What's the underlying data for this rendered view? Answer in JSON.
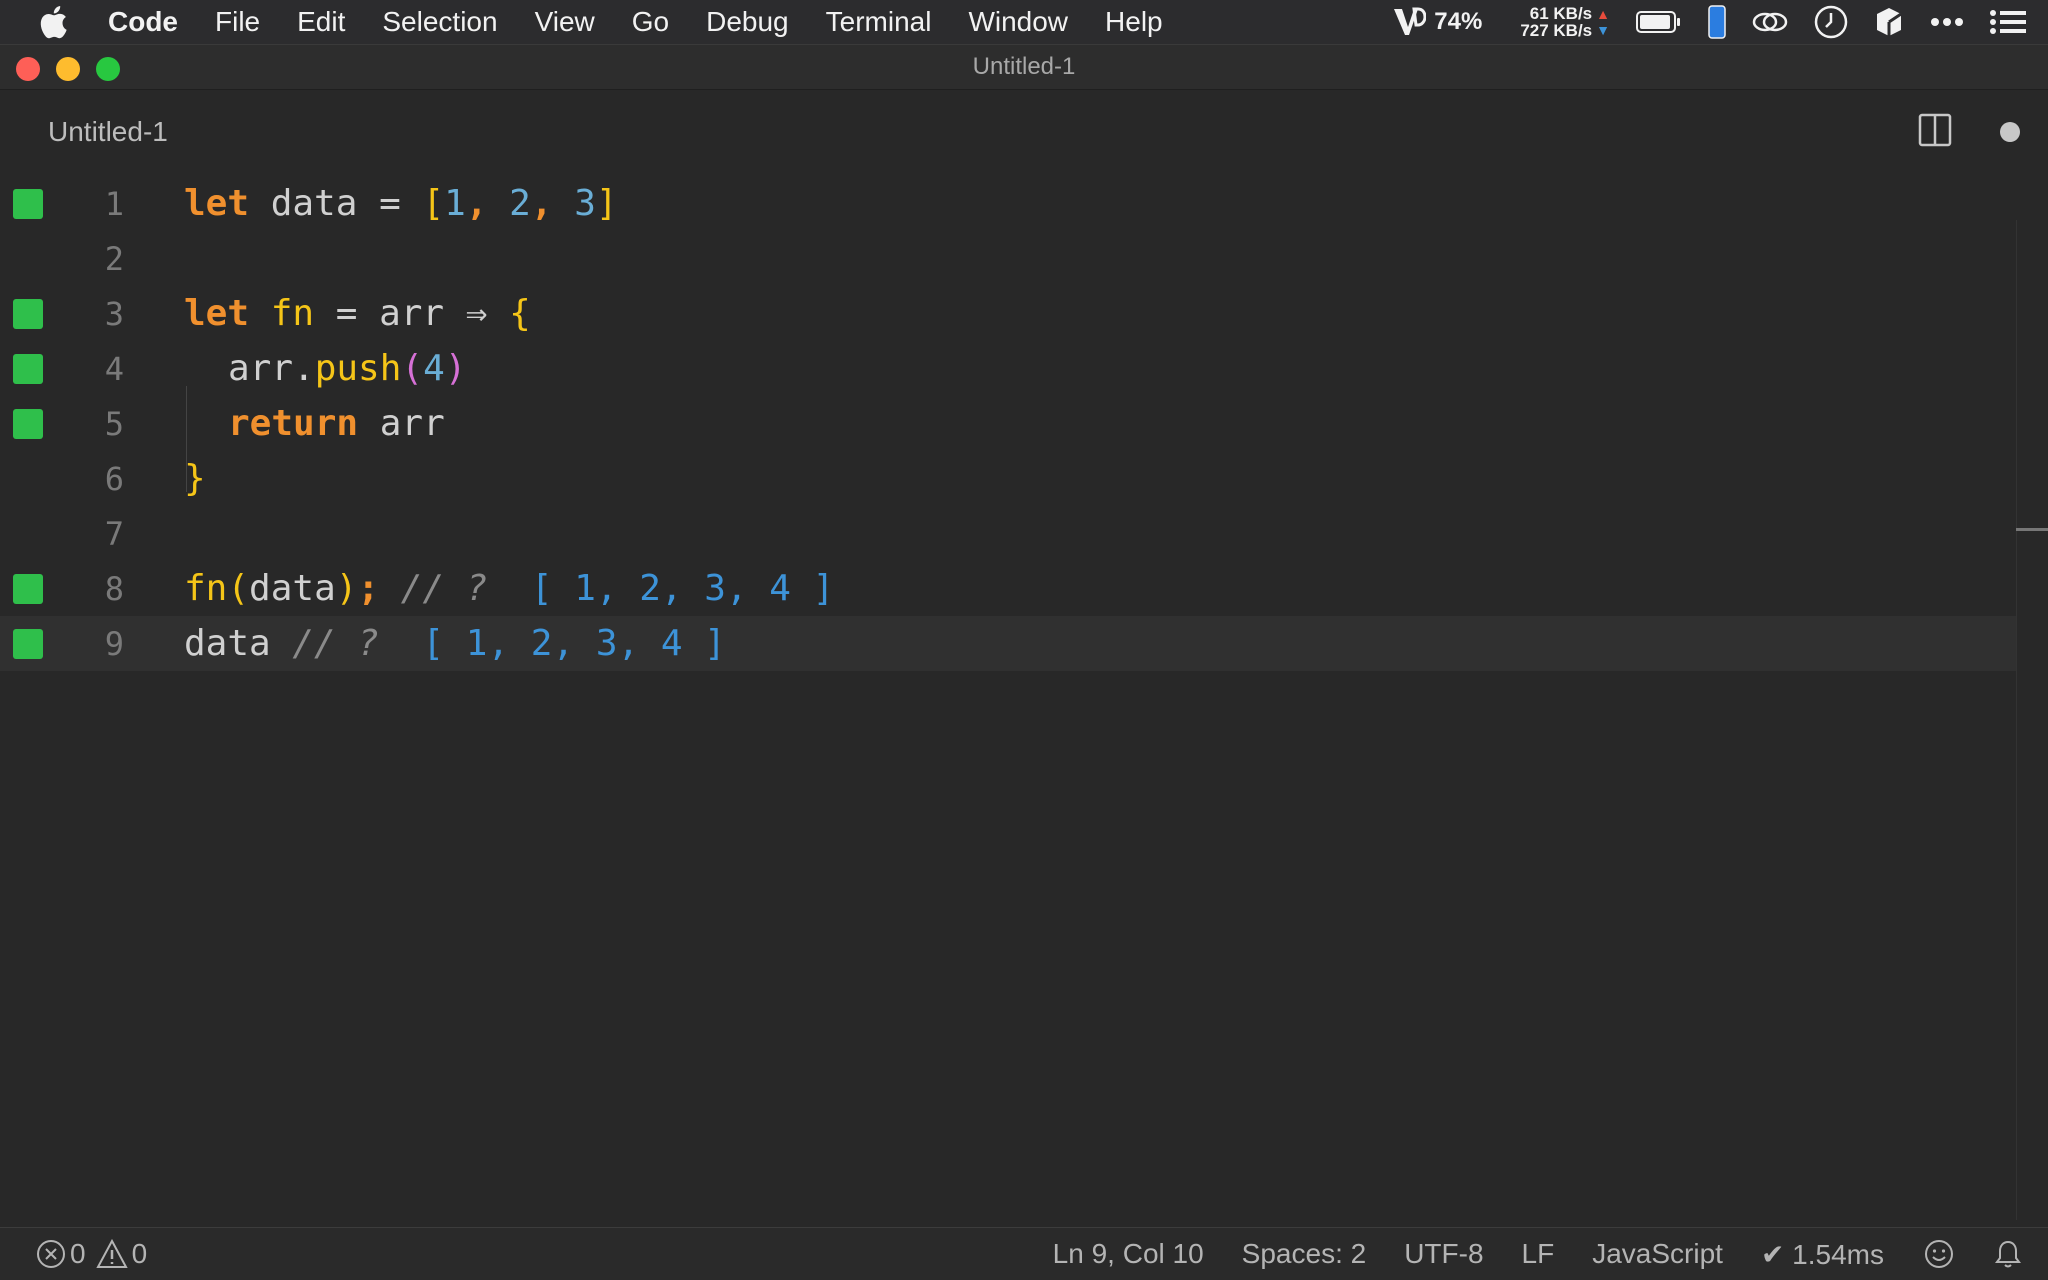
{
  "menubar": {
    "apple_icon": "apple-icon",
    "items": [
      "Code",
      "File",
      "Edit",
      "Selection",
      "View",
      "Go",
      "Debug",
      "Terminal",
      "Window",
      "Help"
    ],
    "status": {
      "battery_app_percent": "74%",
      "upload_rate": "61 KB/s",
      "download_rate": "727 KB/s",
      "icons": [
        "vb-icon",
        "up-arrow-icon",
        "down-arrow-icon",
        "battery-icon",
        "phone-icon",
        "link-icon",
        "clock-icon",
        "cube-icon",
        "more-icon",
        "list-icon"
      ]
    }
  },
  "window": {
    "title": "Untitled-1"
  },
  "tab": {
    "label": "Untitled-1"
  },
  "editor": {
    "lines": [
      {
        "number": "1",
        "marker": true
      },
      {
        "number": "2",
        "marker": false
      },
      {
        "number": "3",
        "marker": true
      },
      {
        "number": "4",
        "marker": true
      },
      {
        "number": "5",
        "marker": true
      },
      {
        "number": "6",
        "marker": false
      },
      {
        "number": "7",
        "marker": false
      },
      {
        "number": "8",
        "marker": true
      },
      {
        "number": "9",
        "marker": true
      }
    ],
    "tokens": {
      "l1": [
        "let",
        " data ",
        "= ",
        "[",
        "1",
        ", ",
        "2",
        ", ",
        "3",
        "]"
      ],
      "l3": [
        "let",
        " fn ",
        "= arr ",
        "⇒",
        " ",
        "{"
      ],
      "l4": [
        "arr.",
        "push",
        "(",
        "4",
        ")"
      ],
      "l5": [
        "return",
        " arr"
      ],
      "l6": [
        "}"
      ],
      "l8": [
        "fn",
        "(",
        "data",
        ")",
        ";",
        " // ? ",
        " [ 1, 2, 3, 4 ]"
      ],
      "l9": [
        "data",
        " // ? ",
        " [ 1, 2, 3, 4 ]"
      ]
    },
    "colors": {
      "marker": "#2fbf4b",
      "keyword": "#f0902e",
      "number": "#6aaed6",
      "bracket": "#f5c518",
      "paren": "#d670d6",
      "result": "#3d93d8"
    }
  },
  "statusbar": {
    "errors": "0",
    "warnings": "0",
    "position": "Ln 9, Col 10",
    "spaces": "Spaces: 2",
    "encoding": "UTF-8",
    "eol": "LF",
    "language": "JavaScript",
    "timing": "✔ 1.54ms"
  }
}
